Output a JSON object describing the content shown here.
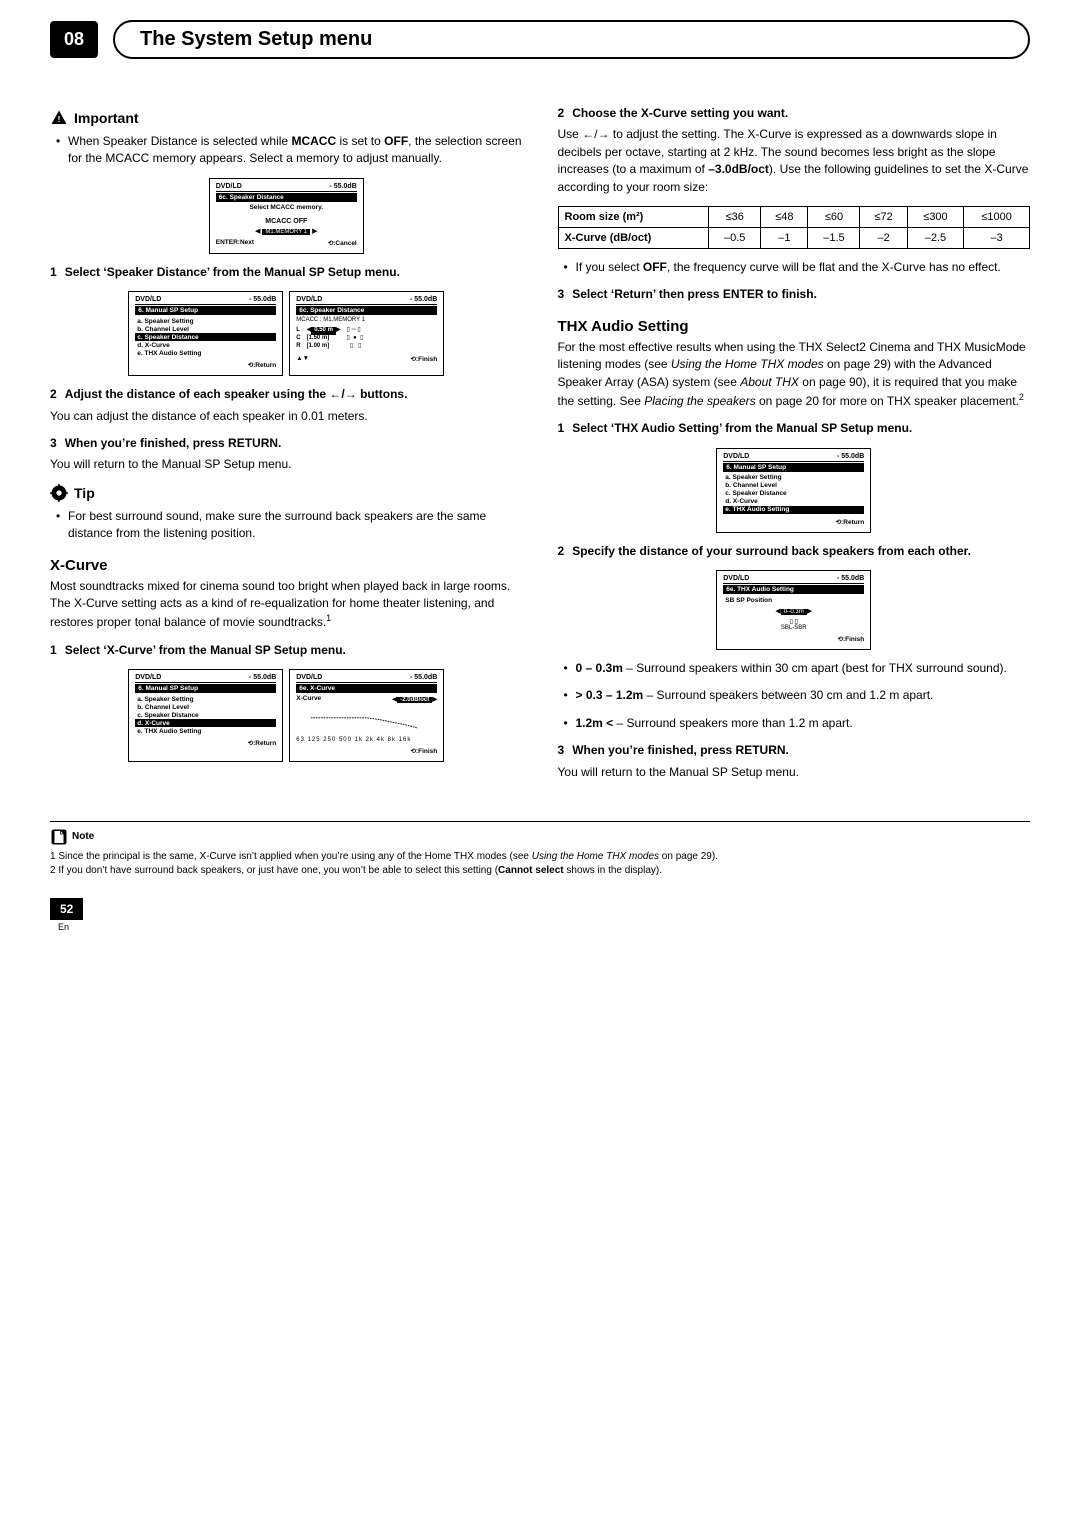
{
  "chapter": {
    "num": "08",
    "title": "The System Setup menu"
  },
  "left": {
    "important_label": "Important",
    "important_bullet_pre": "When Speaker Distance is selected while ",
    "important_bullet_b1": "MCACC",
    "important_bullet_mid": " is set to ",
    "important_bullet_b2": "OFF",
    "important_bullet_post": ", the selection screen for the MCACC memory appears. Select a memory to adjust manually.",
    "screen_mcacc": {
      "src": "DVD/LD",
      "db": "- 55.0dB",
      "title": "6c. Speaker Distance",
      "line1": "Select MCACC memory.",
      "off": "MCACC OFF",
      "mem": "M1.MEMORY 1",
      "foot_l": "ENTER:Next",
      "foot_r": "⟲:Cancel"
    },
    "step1_num": "1",
    "step1_t": "Select ‘Speaker Distance’ from the Manual SP Setup menu.",
    "screen_menu": {
      "src": "DVD/LD",
      "db": "- 55.0dB",
      "title": "6. Manual SP Setup",
      "a": "a. Speaker Setting",
      "b": "b. Channel Level",
      "c": "c. Speaker Distance",
      "d": "d. X-Curve",
      "e": "e. THX Audio Setting",
      "foot": "⟲:Return"
    },
    "screen_dist": {
      "src": "DVD/LD",
      "db": "- 55.0dB",
      "title": "6c. Speaker Distance",
      "mcacc": "MCACC   : M1.MEMORY 1",
      "rows": [
        [
          "L",
          "0.50 m"
        ],
        [
          "C",
          "[1.50 m]"
        ],
        [
          "R",
          "[1.00 m]"
        ]
      ],
      "foot_l": "▲▼",
      "foot_r": "⟲:Finish"
    },
    "step2_num": "2",
    "step2_t_pre": "Adjust the distance of each speaker using the ",
    "step2_t_post": " buttons.",
    "step2_body": "You can adjust the distance of each speaker in 0.01 meters.",
    "step3_num": "3",
    "step3_t": "When you’re finished, press RETURN.",
    "step3_body": "You will return to the Manual SP Setup menu.",
    "tip_label": "Tip",
    "tip_bullet": "For best surround sound, make sure the surround back speakers are the same distance from the listening position.",
    "xcurve_h": "X-Curve",
    "xcurve_p": "Most soundtracks mixed for cinema sound too bright when played back in large rooms. The X-Curve setting acts as a kind of re-equalization for home theater listening, and restores proper tonal balance of movie soundtracks.",
    "xcurve_sup": "1",
    "xstep1_num": "1",
    "xstep1_t": "Select ‘X-Curve’ from the Manual SP Setup menu.",
    "screen_xmenu": {
      "src": "DVD/LD",
      "db": "- 55.0dB",
      "title": "6. Manual SP Setup",
      "a": "a. Speaker Setting",
      "b": "b. Channel Level",
      "c": "c. Speaker Distance",
      "d": "d. X-Curve",
      "e": "e. THX Audio Setting",
      "foot": "⟲:Return"
    },
    "screen_xcurve": {
      "src": "DVD/LD",
      "db": "- 55.0dB",
      "title": "6e. X-Curve",
      "subtitle": "X-Curve",
      "val": "-2.0dB/oct",
      "scale": "63 125 250 500 1k 2k 4k 8k 16k",
      "foot": "⟲:Finish"
    }
  },
  "right": {
    "step2_num": "2",
    "step2_t": "Choose the X-Curve setting you want.",
    "step2_body_pre": "Use ",
    "step2_body_mid": " to adjust the setting. The X-Curve is expressed as a downwards slope in decibels per octave, starting at 2 kHz. The sound becomes less bright as the slope increases (to a maximum of ",
    "step2_body_b": "–3.0dB/oct",
    "step2_body_post": "). Use the following guidelines to set the X-Curve according to your room size:",
    "table": {
      "r1": [
        "Room size (m²)",
        "≤36",
        "≤48",
        "≤60",
        "≤72",
        "≤300",
        "≤1000"
      ],
      "r2": [
        "X-Curve (dB/oct)",
        "–0.5",
        "–1",
        "–1.5",
        "–2",
        "–2.5",
        "–3"
      ]
    },
    "off_bullet_pre": "If you select ",
    "off_bullet_b": "OFF",
    "off_bullet_post": ", the frequency curve will be flat and the X-Curve has no effect.",
    "step3_num": "3",
    "step3_t": "Select ‘Return’ then press ENTER to finish.",
    "thx_h": "THX Audio Setting",
    "thx_p1": "For the most effective results when using the THX Select2 Cinema and THX MusicMode listening modes (see ",
    "thx_i1": "Using the Home THX modes",
    "thx_p2": " on page 29) with the Advanced Speaker Array (ASA) system (see ",
    "thx_i2": "About THX",
    "thx_p3": " on page 90), it is required that you make the setting. See ",
    "thx_i3": "Placing the speakers",
    "thx_p4": " on page 20 for more on THX speaker placement.",
    "thx_sup": "2",
    "tstep1_num": "1",
    "tstep1_t": "Select ‘THX Audio Setting’ from the Manual SP Setup menu.",
    "screen_thxmenu": {
      "src": "DVD/LD",
      "db": "- 55.0dB",
      "title": "6. Manual SP Setup",
      "a": "a. Speaker Setting",
      "b": "b. Channel Level",
      "c": "c. Speaker Distance",
      "d": "d. X-Curve",
      "e": "e. THX Audio Setting",
      "foot": "⟲:Return"
    },
    "tstep2_num": "2",
    "tstep2_t": "Specify the distance of your surround back speakers from each other.",
    "screen_thx": {
      "src": "DVD/LD",
      "db": "- 55.0dB",
      "title": "6e. THX Audio Setting",
      "sub": "SB SP Position",
      "val": "0–0.3m",
      "spk": "SBL-SBR",
      "foot": "⟲:Finish"
    },
    "b1_b": "0 – 0.3m",
    "b1_t": " – Surround speakers within 30 cm apart (best for THX surround sound).",
    "b2_b": "> 0.3 – 1.2m",
    "b2_t": " – Surround speakers between 30 cm and 1.2 m apart.",
    "b3_b": "1.2m <",
    "b3_t": " – Surround speakers more than 1.2 m apart.",
    "tstep3_num": "3",
    "tstep3_t": "When you’re finished, press RETURN.",
    "tstep3_body": "You will return to the Manual SP Setup menu."
  },
  "footnotes": {
    "label": "Note",
    "n1_pre": "1 Since the principal is the same, X-Curve isn’t applied when you’re using any of the Home THX modes (see ",
    "n1_i": "Using the Home THX modes",
    "n1_post": " on page 29).",
    "n2_pre": "2 If you don’t have surround back speakers, or just have one, you won’t be able to select this setting (",
    "n2_b": "Cannot select",
    "n2_post": " shows in the display)."
  },
  "page": {
    "num": "52",
    "lang": "En"
  }
}
